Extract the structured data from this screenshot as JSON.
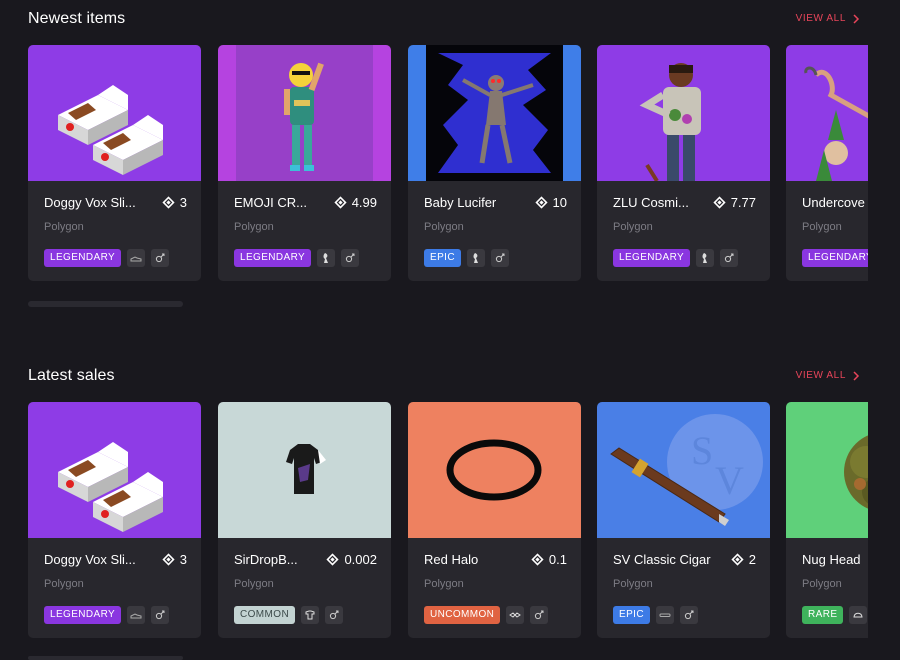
{
  "newest": {
    "title": "Newest items",
    "view_all": "VIEW ALL",
    "cards": [
      {
        "name": "Doggy Vox Sli...",
        "price": "3",
        "chain": "Polygon",
        "rarity": "LEGENDARY",
        "rarity_color": "#8a36e0",
        "bg": "#8e3ce6",
        "icons": [
          "shoe-icon",
          "gender-icon"
        ]
      },
      {
        "name": "EMOJI CR...",
        "price": "4.99",
        "chain": "Polygon",
        "rarity": "LEGENDARY",
        "rarity_color": "#8a36e0",
        "bg": "#b543e0",
        "icons": [
          "body-icon",
          "gender-icon"
        ]
      },
      {
        "name": "Baby Lucifer",
        "price": "10",
        "chain": "Polygon",
        "rarity": "EPIC",
        "rarity_color": "#3d7be6",
        "bg": "#3f7ee8",
        "icons": [
          "body-icon",
          "gender-icon"
        ]
      },
      {
        "name": "ZLU Cosmi...",
        "price": "7.77",
        "chain": "Polygon",
        "rarity": "LEGENDARY",
        "rarity_color": "#8a36e0",
        "bg": "#8e3ce6",
        "icons": [
          "body-icon",
          "gender-icon"
        ]
      },
      {
        "name": "Undercove",
        "price": "",
        "chain": "Polygon",
        "rarity": "LEGENDARY",
        "rarity_color": "#8a36e0",
        "bg": "#8e3ce6",
        "icons": []
      }
    ]
  },
  "sales": {
    "title": "Latest sales",
    "view_all": "VIEW ALL",
    "cards": [
      {
        "name": "Doggy Vox Sli...",
        "price": "3",
        "chain": "Polygon",
        "rarity": "LEGENDARY",
        "rarity_color": "#8a36e0",
        "bg": "#8e3ce6",
        "icons": [
          "shoe-icon",
          "gender-icon"
        ]
      },
      {
        "name": "SirDropB...",
        "price": "0.002",
        "chain": "Polygon",
        "rarity": "COMMON",
        "rarity_color": "#c3d3d2",
        "bg": "#c8d8d7",
        "icons": [
          "shirt-icon",
          "gender-icon"
        ]
      },
      {
        "name": "Red Halo",
        "price": "0.1",
        "chain": "Polygon",
        "rarity": "UNCOMMON",
        "rarity_color": "#e06342",
        "bg": "#ee8160",
        "icons": [
          "mask-icon",
          "gender-icon"
        ]
      },
      {
        "name": "SV Classic Cigar",
        "price": "2",
        "chain": "Polygon",
        "rarity": "EPIC",
        "rarity_color": "#3d7be6",
        "bg": "#4a7fe6",
        "icons": [
          "cigar-icon",
          "gender-icon"
        ]
      },
      {
        "name": "Nug Head",
        "price": "",
        "chain": "Polygon",
        "rarity": "RARE",
        "rarity_color": "#3fb35c",
        "bg": "#5fd07a",
        "icons": [
          "hat-icon"
        ]
      }
    ]
  }
}
